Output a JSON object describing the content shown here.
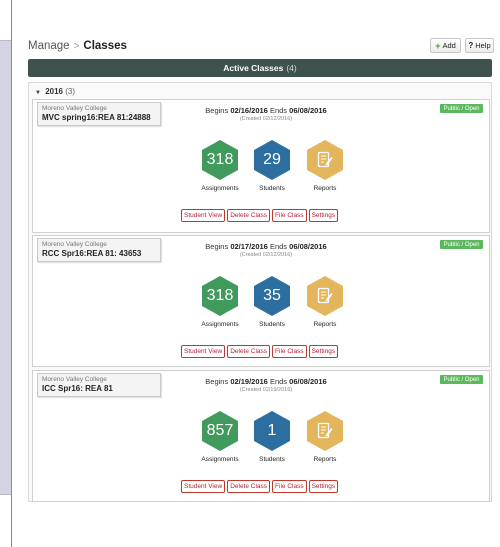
{
  "header": {
    "breadcrumb_root": "Manage",
    "breadcrumb_sep": ">",
    "breadcrumb_current": "Classes",
    "add_label": "Add",
    "help_label": "Help"
  },
  "active_bar": {
    "title": "Active Classes",
    "count": "(4)"
  },
  "year_group": {
    "year": "2016",
    "count": "(3)"
  },
  "classes": [
    {
      "school": "Moreno Valley College",
      "name": "MVC spring16:REA 81:24888",
      "status": "Public / Open",
      "begins_label": "Begins",
      "begins": "02/16/2016",
      "ends_label": "Ends",
      "ends": "06/08/2016",
      "created": "(Created 02/12/2016)",
      "assignments": "318",
      "students": "29",
      "assignments_label": "Assignments",
      "students_label": "Students",
      "reports_label": "Reports",
      "actions": [
        "Student View",
        "Delete Class",
        "File Class",
        "Settings"
      ]
    },
    {
      "school": "Moreno Valley College",
      "name": "RCC Spr16:REA 81: 43653",
      "status": "Public / Open",
      "begins_label": "Begins",
      "begins": "02/17/2016",
      "ends_label": "Ends",
      "ends": "06/08/2016",
      "created": "(Created 02/12/2016)",
      "assignments": "318",
      "students": "35",
      "assignments_label": "Assignments",
      "students_label": "Students",
      "reports_label": "Reports",
      "actions": [
        "Student View",
        "Delete Class",
        "File Class",
        "Settings"
      ]
    },
    {
      "school": "Moreno Valley College",
      "name": "ICC Spr16: REA 81",
      "status": "Public / Open",
      "begins_label": "Begins",
      "begins": "02/19/2016",
      "ends_label": "Ends",
      "ends": "06/08/2016",
      "created": "(Created 02/19/2016)",
      "assignments": "857",
      "students": "1",
      "assignments_label": "Assignments",
      "students_label": "Students",
      "reports_label": "Reports",
      "actions": [
        "Student View",
        "Delete Class",
        "File Class",
        "Settings"
      ]
    }
  ],
  "colors": {
    "active_bar": "#3e5250",
    "status_badge": "#5cb85c",
    "assignments_hex": "#3f9a5c",
    "students_hex": "#2c6ea0",
    "reports_hex": "#e3b55d",
    "action_button_text": "#b8203a"
  },
  "icons": {
    "reports": "report-document-pencil-icon",
    "add": "plus-icon",
    "help": "question-mark-icon",
    "year_toggle": "caret-down-icon"
  }
}
